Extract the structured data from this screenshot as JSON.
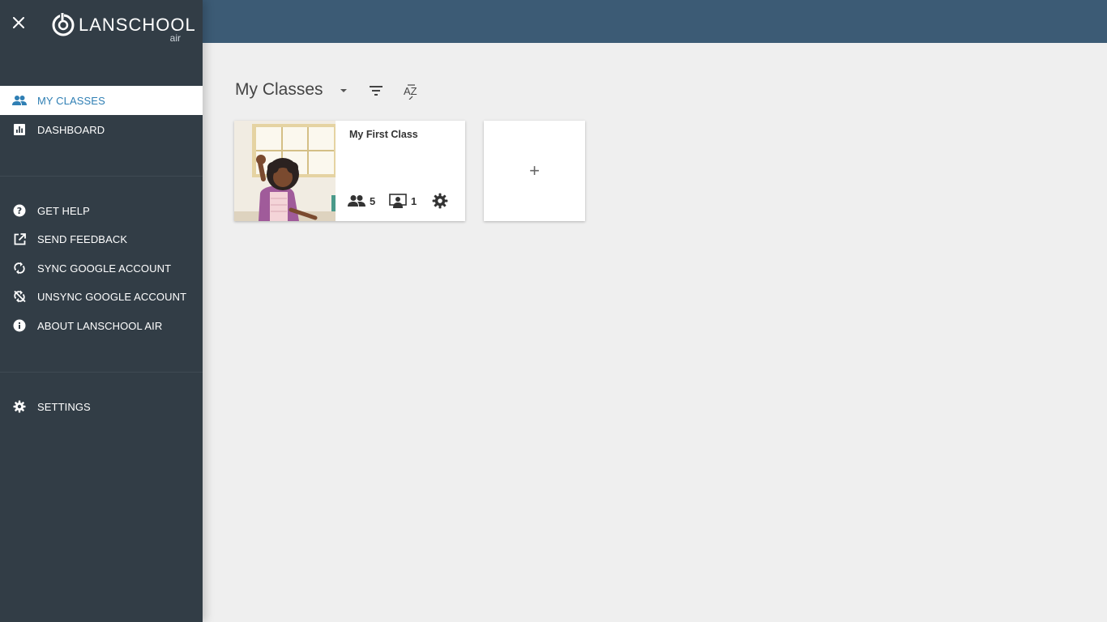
{
  "app": {
    "logo_text": "LANSCHOOL",
    "logo_subtext": "air"
  },
  "sidebar": {
    "primary_items": [
      {
        "label": "MY CLASSES",
        "icon": "people-icon",
        "active": true
      },
      {
        "label": "DASHBOARD",
        "icon": "bar-chart-icon",
        "active": false
      }
    ],
    "secondary_items": [
      {
        "label": "GET HELP",
        "icon": "help-icon"
      },
      {
        "label": "SEND FEEDBACK",
        "icon": "external-link-icon"
      },
      {
        "label": "SYNC GOOGLE ACCOUNT",
        "icon": "sync-icon"
      },
      {
        "label": "UNSYNC GOOGLE ACCOUNT",
        "icon": "sync-disabled-icon"
      },
      {
        "label": "ABOUT LANSCHOOL AIR",
        "icon": "info-icon"
      }
    ],
    "tertiary_items": [
      {
        "label": "SETTINGS",
        "icon": "gear-icon"
      }
    ]
  },
  "main": {
    "title": "My Classes",
    "sort_label": "AZ",
    "classes": [
      {
        "name": "My First Class",
        "students_count": "5",
        "devices_count": "1"
      }
    ],
    "add_label": "+"
  },
  "colors": {
    "topbar": "#3c5b75",
    "sidebar": "#323d46",
    "accent": "#2f7fb4",
    "background": "#efefef"
  }
}
